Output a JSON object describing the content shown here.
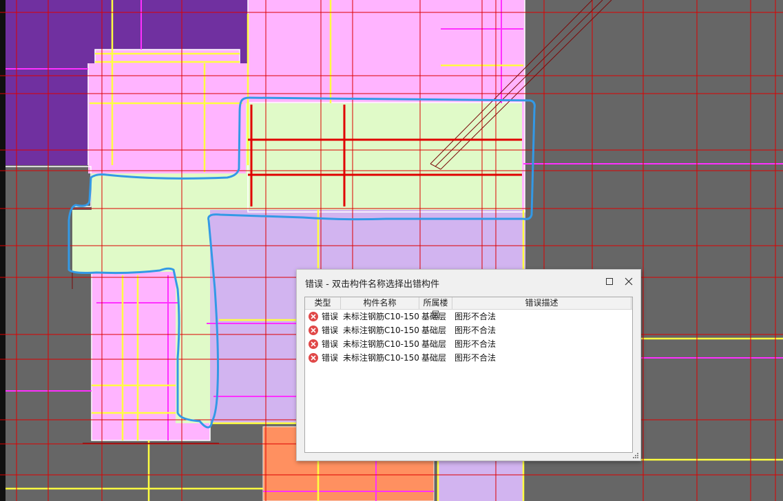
{
  "dialog": {
    "title": "错误 - 双击构件名称选择出错构件",
    "columns": [
      "类型",
      "构件名称",
      "所属楼层",
      "错误描述"
    ],
    "rows": [
      {
        "type": "错误",
        "name": "未标注钢筋C10-150",
        "floor": "基础层",
        "desc": "图形不合法"
      },
      {
        "type": "错误",
        "name": "未标注钢筋C10-150",
        "floor": "基础层",
        "desc": "图形不合法"
      },
      {
        "type": "错误",
        "name": "未标注钢筋C10-150",
        "floor": "基础层",
        "desc": "图形不合法"
      },
      {
        "type": "错误",
        "name": "未标注钢筋C10-150",
        "floor": "基础层",
        "desc": "图形不合法"
      }
    ],
    "icons": {
      "row": "error-circle-icon",
      "maximize": "maximize-icon",
      "close": "close-icon",
      "grip": "resize-grip-icon"
    }
  },
  "colors": {
    "background": "#666666",
    "pink_region": "#ffb4ff",
    "purple_region": "#7030a0",
    "lavender_region": "#d2b4f0",
    "green_region": "#e0fac8",
    "orange_region": "#ff9060",
    "grid_line": "#dd0000",
    "yellow_line": "#ffff40",
    "magenta_line": "#ff30ff",
    "outline_annotation": "#3399e6",
    "error_icon": "#e04848"
  }
}
